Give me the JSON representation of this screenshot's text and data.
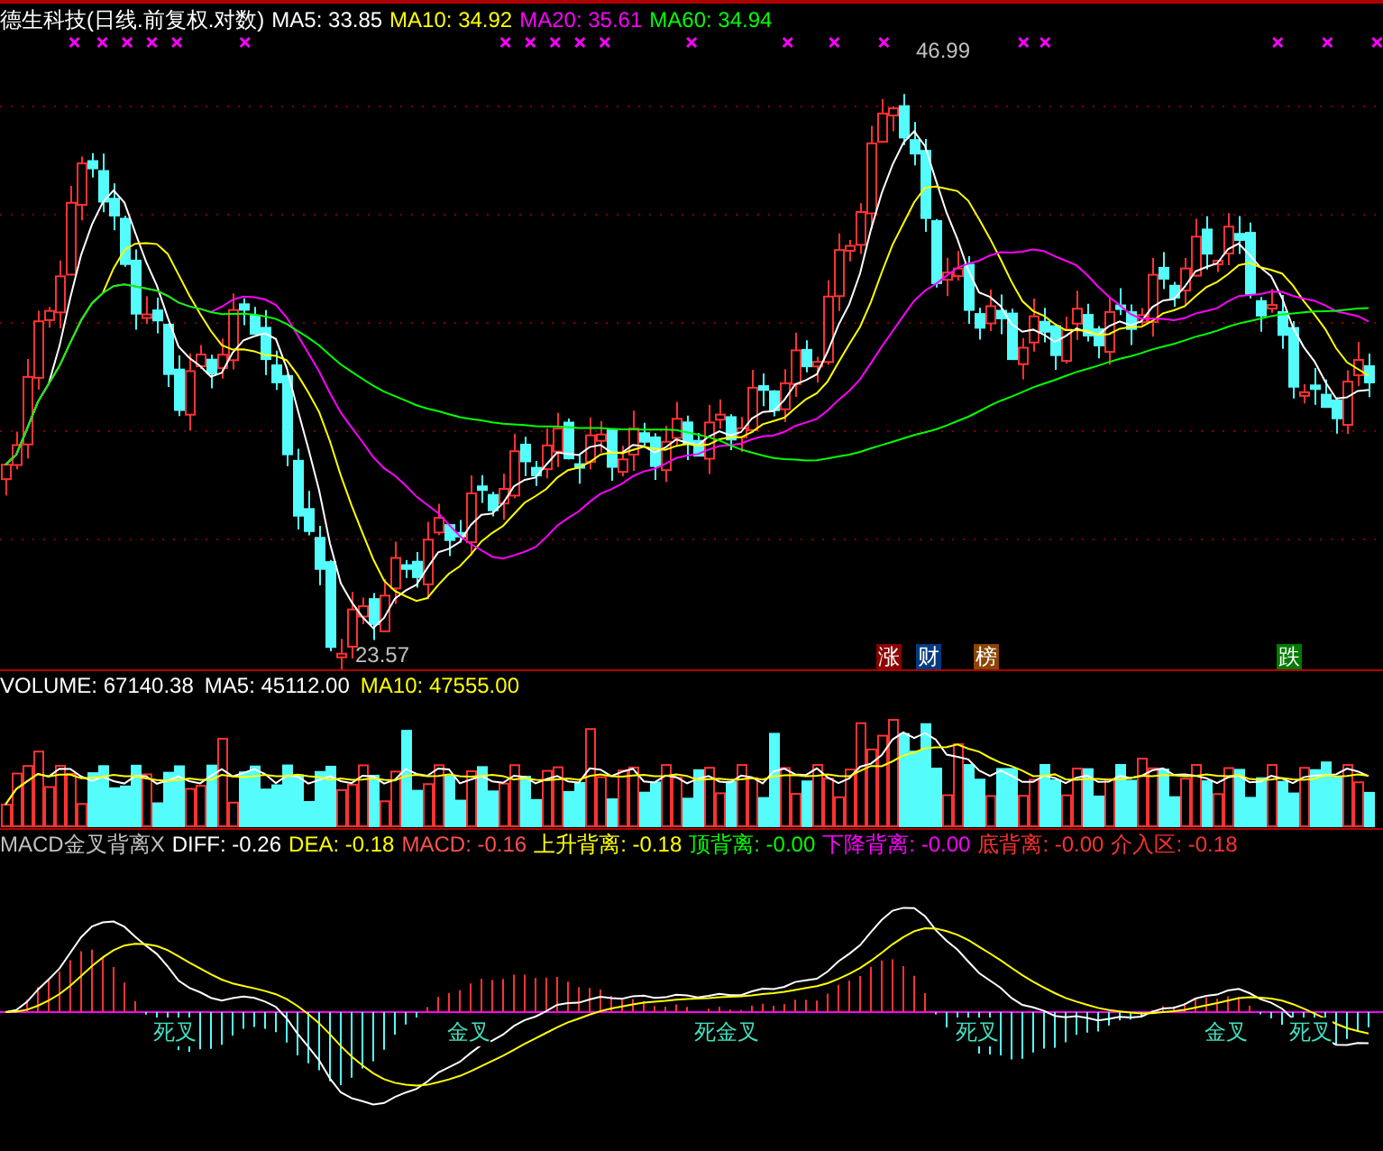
{
  "price_panel": {
    "title": "德生科技(日线.前复权.对数)",
    "indicators": [
      {
        "label": "MA5: 33.85",
        "color": "#ffffff"
      },
      {
        "label": "MA10: 34.92",
        "color": "#ffff00"
      },
      {
        "label": "MA20: 35.61",
        "color": "#ff00ff"
      },
      {
        "label": "MA60: 34.94",
        "color": "#00ff00"
      }
    ],
    "high_label": "46.99",
    "low_label": "23.57",
    "event_tags": [
      {
        "label": "涨",
        "color": "#8b0000"
      },
      {
        "label": "财",
        "color": "#003a80"
      },
      {
        "label": "榜",
        "color": "#8b4500"
      },
      {
        "label": "跌",
        "color": "#007a00"
      }
    ]
  },
  "volume_panel": {
    "indicators": [
      {
        "label": "VOLUME: 67140.38",
        "color": "#ffffff"
      },
      {
        "label": "MA5: 45112.00",
        "color": "#ffffff"
      },
      {
        "label": "MA10: 47555.00",
        "color": "#ffff00"
      }
    ]
  },
  "macd_panel": {
    "indicators": [
      {
        "label": "MACD金叉背离X",
        "color": "#c0c0c0"
      },
      {
        "label": "DIFF: -0.26",
        "color": "#ffffff"
      },
      {
        "label": "DEA: -0.18",
        "color": "#ffff00"
      },
      {
        "label": "MACD: -0.16",
        "color": "#ff5050"
      },
      {
        "label": "上升背离: -0.18",
        "color": "#ffff00"
      },
      {
        "label": "顶背离: -0.00",
        "color": "#00ff00"
      },
      {
        "label": "下降背离: -0.00",
        "color": "#ff00ff"
      },
      {
        "label": "底背离: -0.00",
        "color": "#ff3030"
      },
      {
        "label": "介入区: -0.18",
        "color": "#ff3030"
      }
    ],
    "cross_labels": [
      "死叉",
      "金叉",
      "死金叉",
      "死叉",
      "金叉",
      "死叉"
    ]
  }
}
